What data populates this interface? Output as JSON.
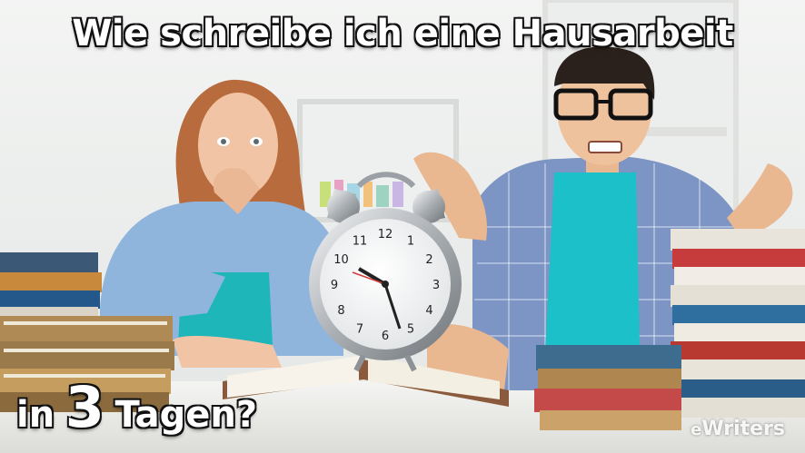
{
  "headline": "Wie schreibe ich eine Hausarbeit",
  "subline": {
    "prefix": "in",
    "number": "3",
    "suffix": "Tagen?"
  },
  "brand": {
    "mark": "e",
    "name": "Writers"
  },
  "clock": {
    "numbers": [
      "12",
      "1",
      "2",
      "3",
      "4",
      "5",
      "6",
      "7",
      "8",
      "9",
      "10",
      "11"
    ]
  }
}
